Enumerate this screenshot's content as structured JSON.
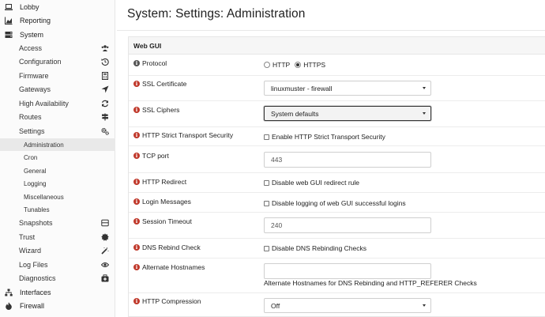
{
  "sidebar": {
    "top_items": [
      {
        "label": "Lobby",
        "icon": "laptop-icon"
      },
      {
        "label": "Reporting",
        "icon": "area-chart-icon"
      },
      {
        "label": "System",
        "icon": "server-icon"
      }
    ],
    "system_items": [
      {
        "label": "Access",
        "icon": "users-icon"
      },
      {
        "label": "Configuration",
        "icon": "history-icon"
      },
      {
        "label": "Firmware",
        "icon": "calculator-icon"
      },
      {
        "label": "Gateways",
        "icon": "location-arrow-icon"
      },
      {
        "label": "High Availability",
        "icon": "refresh-icon"
      },
      {
        "label": "Routes",
        "icon": "map-signs-icon"
      },
      {
        "label": "Settings",
        "icon": "cogs-icon"
      }
    ],
    "settings_items": [
      {
        "label": "Administration",
        "active": true
      },
      {
        "label": "Cron"
      },
      {
        "label": "General"
      },
      {
        "label": "Logging"
      },
      {
        "label": "Miscellaneous"
      },
      {
        "label": "Tunables"
      }
    ],
    "system_items_after": [
      {
        "label": "Snapshots",
        "icon": "window-icon"
      },
      {
        "label": "Trust",
        "icon": "certificate-icon"
      },
      {
        "label": "Wizard",
        "icon": "magic-icon"
      },
      {
        "label": "Log Files",
        "icon": "eye-icon"
      },
      {
        "label": "Diagnostics",
        "icon": "medkit-icon"
      }
    ],
    "bottom_items": [
      {
        "label": "Interfaces",
        "icon": "sitemap-icon"
      },
      {
        "label": "Firewall",
        "icon": "fire-icon"
      }
    ]
  },
  "header": {
    "title": "System: Settings: Administration"
  },
  "panel": {
    "title": "Web GUI",
    "rows": {
      "protocol": {
        "label": "Protocol",
        "options": [
          "HTTP",
          "HTTPS"
        ],
        "selected": "HTTPS"
      },
      "ssl_certificate": {
        "label": "SSL Certificate",
        "value": "linuxmuster - firewall"
      },
      "ssl_ciphers": {
        "label": "SSL Ciphers",
        "value": "System defaults"
      },
      "hsts": {
        "label": "HTTP Strict Transport Security",
        "checkbox_label": "Enable HTTP Strict Transport Security",
        "checked": false
      },
      "tcp_port": {
        "label": "TCP port",
        "placeholder": "443"
      },
      "http_redirect": {
        "label": "HTTP Redirect",
        "checkbox_label": "Disable web GUI redirect rule",
        "checked": false
      },
      "login_messages": {
        "label": "Login Messages",
        "checkbox_label": "Disable logging of web GUI successful logins",
        "checked": false
      },
      "session_timeout": {
        "label": "Session Timeout",
        "placeholder": "240"
      },
      "dns_rebind": {
        "label": "DNS Rebind Check",
        "checkbox_label": "Disable DNS Rebinding Checks",
        "checked": false
      },
      "alt_hostnames": {
        "label": "Alternate Hostnames",
        "value": "",
        "help": "Alternate Hostnames for DNS Rebinding and HTTP_REFERER Checks"
      },
      "http_compression": {
        "label": "HTTP Compression",
        "value": "Off"
      }
    }
  },
  "colors": {
    "info_red": "#c0392b",
    "info_grey": "#555555",
    "active_bg": "#e9e9e9"
  }
}
